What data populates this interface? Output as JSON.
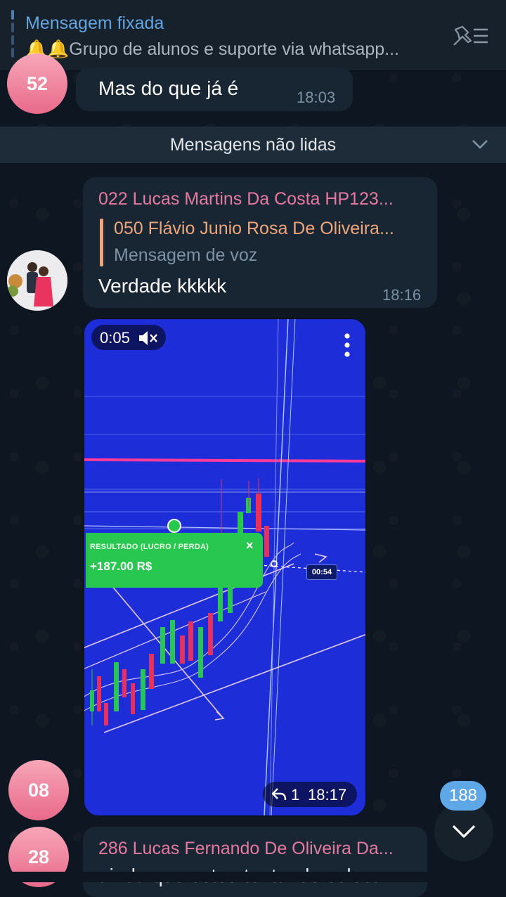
{
  "pinned": {
    "title": "Mensagem fixada",
    "emoji": "🔔🔔",
    "text": "Grupo de alunos e suporte via whatsapp..."
  },
  "messages": [
    {
      "avatar": "52",
      "text": "Mas do que já é",
      "time": "18:03"
    },
    {
      "sender": "022 Lucas Martins Da Costa HP123...",
      "reply_name": "050 Flávio Junio Rosa De Oliveira...",
      "reply_kind": "Mensagem de voz",
      "text": "Verdade kkkkk",
      "time": "18:16"
    }
  ],
  "unread_divider": "Mensagens não lidas",
  "video": {
    "duration": "0:05",
    "reply_count": "1",
    "time": "18:17",
    "overlay_label": "RESULTADO (LUCRO / PERDA)",
    "overlay_value": "+187.00 R$",
    "overlay_close": "×",
    "timer": "00:54"
  },
  "avatars_bottom": [
    "08",
    "28"
  ],
  "last_message": {
    "sender": "286 Lucas Fernando De Oliveira Da...",
    "preview": "ainda que estou tentando colocar"
  },
  "scroll": {
    "unread_count": "188"
  },
  "colors": {
    "background": "#0e1621",
    "bubble": "#182533",
    "accent": "#5ea8e8",
    "sender_name": "#e57aa1",
    "reply_name": "#f0a67a",
    "candle_up": "#28c850",
    "candle_down": "#e8305a"
  }
}
